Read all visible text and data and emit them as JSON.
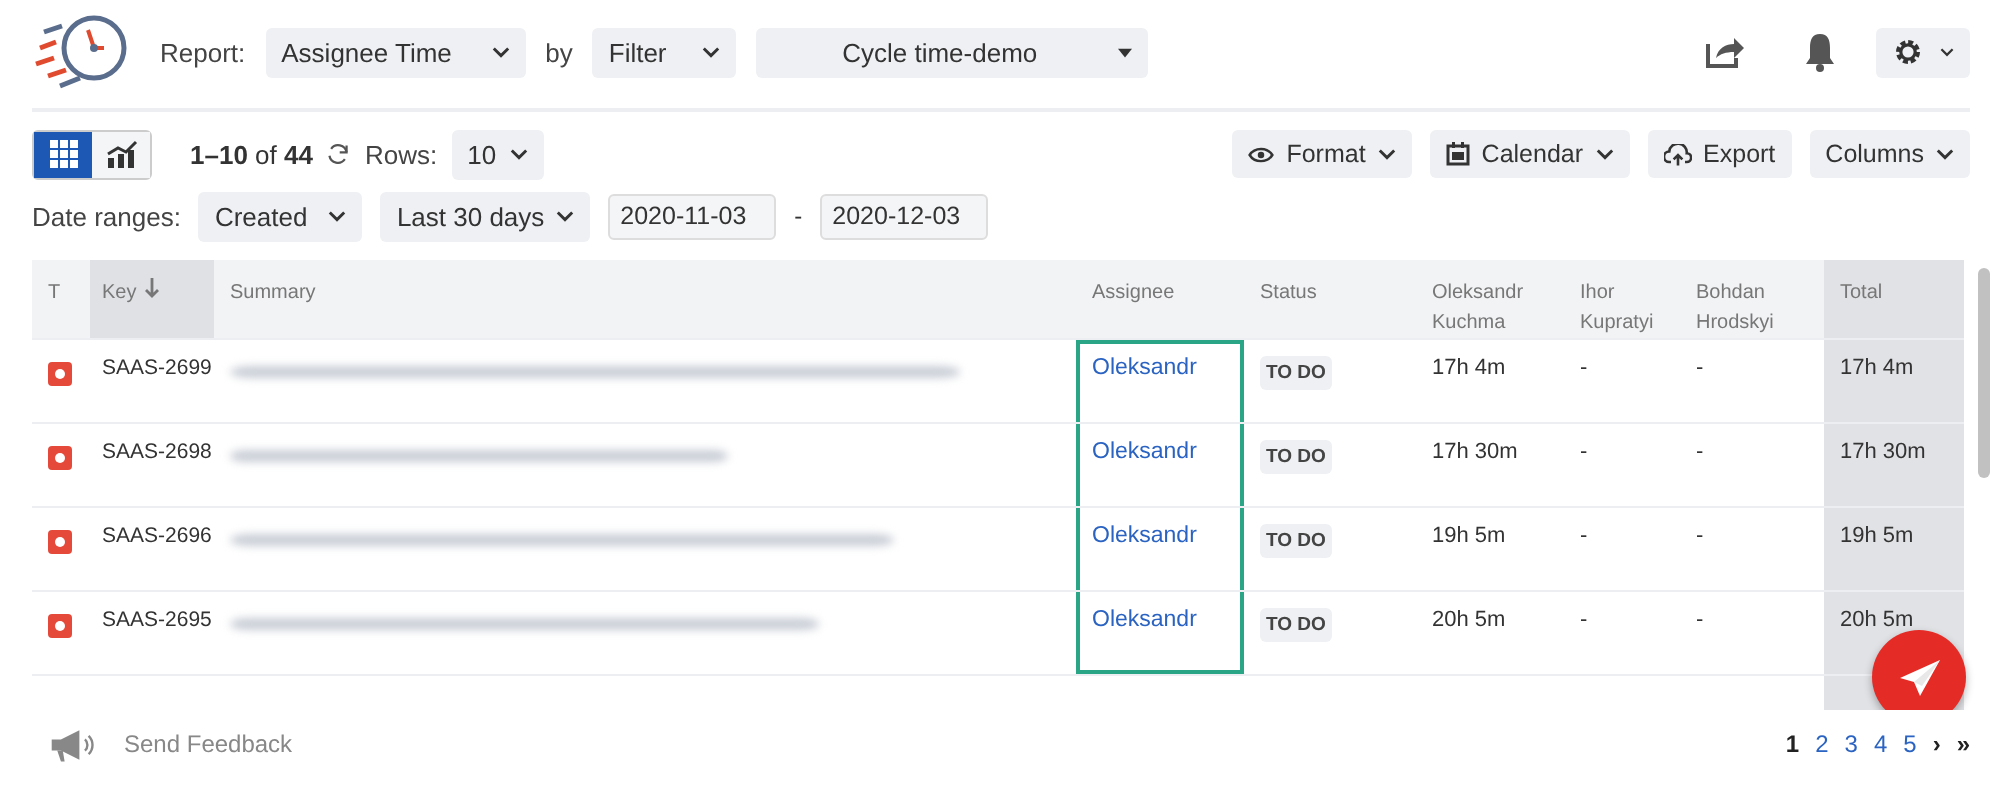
{
  "header": {
    "report_label": "Report:",
    "report": "Assignee Time",
    "by_label": "by",
    "by": "Filter",
    "filter": "Cycle time-demo"
  },
  "view_toggle": [
    {
      "kind": "grid",
      "selected": true
    },
    {
      "kind": "chart",
      "selected": false
    }
  ],
  "range": {
    "from_to": "1–10",
    "of": "of",
    "total": "44",
    "rows_label": "Rows:",
    "rows": "10"
  },
  "actions": [
    {
      "kind": "eye",
      "label": "Format",
      "caret": true
    },
    {
      "kind": "calendar",
      "label": "Calendar",
      "caret": true
    },
    {
      "kind": "cloud",
      "label": "Export",
      "caret": false
    },
    {
      "kind": "none",
      "label": "Columns",
      "caret": true
    }
  ],
  "dates": {
    "label": "Date ranges:",
    "field": "Created",
    "period": "Last 30 days",
    "start": "2020-11-03",
    "sep": "-",
    "end": "2020-12-03"
  },
  "table": {
    "columns": [
      {
        "label": "T"
      },
      {
        "label": "Key",
        "sorted": true
      },
      {
        "label": "Summary"
      },
      {
        "label": "Assignee"
      },
      {
        "label": "Status"
      },
      {
        "label": "Oleksandr Kuchma"
      },
      {
        "label": "Ihor Kupratyi"
      },
      {
        "label": "Bohdan Hrodskyi"
      },
      {
        "label": "Total"
      }
    ],
    "rows": [
      {
        "key": "SAAS-2699",
        "assignee": "Oleksandr",
        "highlighted": true,
        "status": "TO DO",
        "t1": "17h 4m",
        "t2": "-",
        "t3": "-",
        "total": "17h 4m"
      },
      {
        "key": "SAAS-2698",
        "assignee": "Oleksandr",
        "highlighted": true,
        "status": "TO DO",
        "t1": "17h 30m",
        "t2": "-",
        "t3": "-",
        "total": "17h 30m"
      },
      {
        "key": "SAAS-2696",
        "assignee": "Oleksandr",
        "highlighted": true,
        "status": "TO DO",
        "t1": "19h 5m",
        "t2": "-",
        "t3": "-",
        "total": "19h 5m"
      },
      {
        "key": "SAAS-2695",
        "assignee": "Oleksandr",
        "highlighted": true,
        "status": "TO DO",
        "t1": "20h 5m",
        "t2": "-",
        "t3": "-",
        "total": "20h 5m"
      }
    ]
  },
  "feedback": "Send Feedback",
  "pages": [
    {
      "label": "1",
      "selected": true
    },
    {
      "label": "2",
      "selected": false
    },
    {
      "label": "3",
      "selected": false
    },
    {
      "label": "4",
      "selected": false
    },
    {
      "label": "5",
      "selected": false
    }
  ],
  "page_next": "›",
  "page_last": "»"
}
